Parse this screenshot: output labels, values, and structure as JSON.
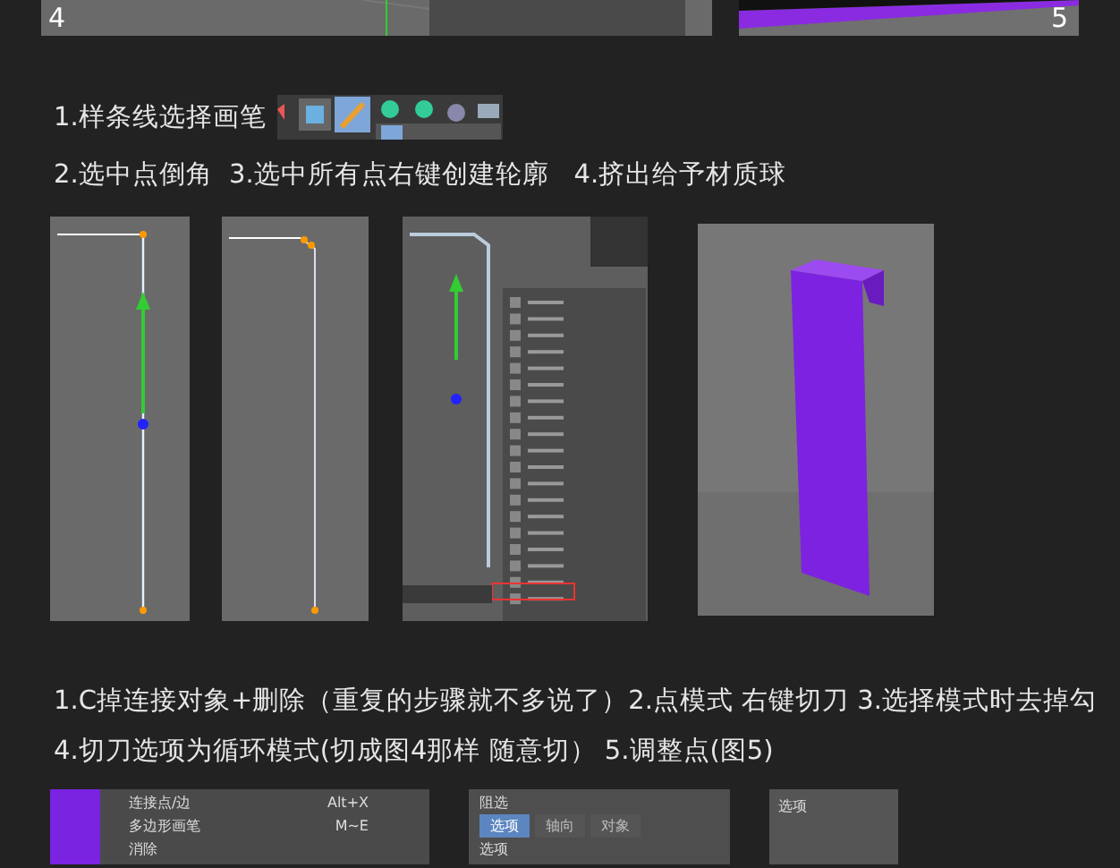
{
  "top_figures": [
    {
      "label": "4"
    },
    {
      "label": "5"
    }
  ],
  "step1": "1.样条线选择画笔",
  "step2": "2.选中点倒角  3.选中所有点右键创建轮廓   4.挤出给予材质球",
  "paragraph": [
    "1.C掉连接对象+删除（重复的步骤就不多说了）2.点模式 右键切刀 3.选择模式时去掉勾",
    "4.切刀选项为循环模式(切成图4那样 随意切） 5.调整点(图5)"
  ],
  "bottom_menu": [
    {
      "label": "连接点/边",
      "shortcut": "Alt+X"
    },
    {
      "label": "多边形画笔",
      "shortcut": "M~E"
    },
    {
      "label": "消除"
    }
  ],
  "bottom_panel": {
    "title": "阻选",
    "tabs": [
      {
        "label": "选项",
        "selected": true
      },
      {
        "label": "轴向",
        "selected": false
      },
      {
        "label": "对象",
        "selected": false
      }
    ],
    "section": "选项"
  },
  "right_panel": {
    "title": "选项"
  }
}
